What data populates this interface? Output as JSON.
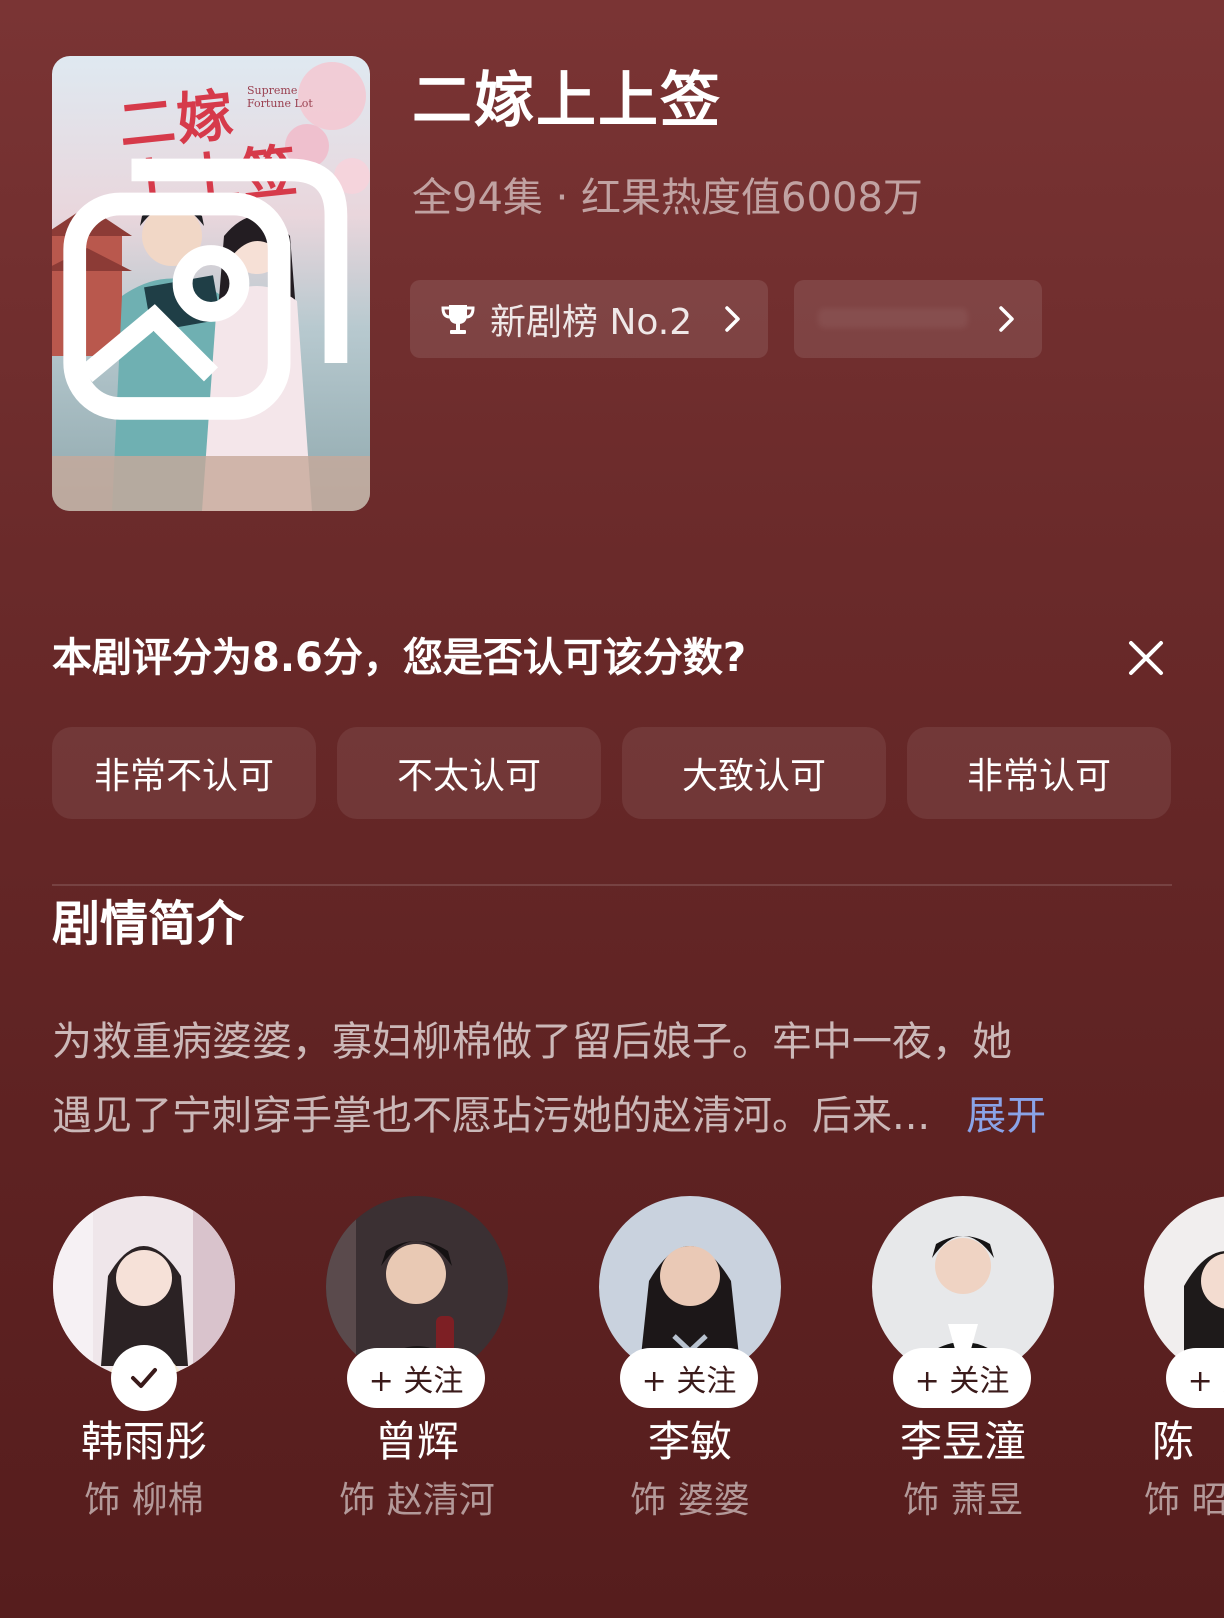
{
  "drama": {
    "title": "二嫁上上签",
    "meta": "全94集 · 红果热度值6008万",
    "poster_title": "二嫁\n上上签",
    "poster_subtitle": "Supreme\nFortune Lot",
    "rank_chip": "新剧榜 No.2"
  },
  "rating": {
    "question": "本剧评分为8.6分，您是否认可该分数?",
    "options": [
      "非常不认可",
      "不太认可",
      "大致认可",
      "非常认可"
    ]
  },
  "synopsis": {
    "section_title": "剧情简介",
    "line1": "为救重病婆婆，寡妇柳棉做了留后娘子。牢中一夜，她",
    "line2": "遇见了宁刺穿手掌也不愿玷污她的赵清河。后来...",
    "expand_label": "展开"
  },
  "cast": {
    "follow_label": "+ 关注",
    "members": [
      {
        "name": "韩雨彤",
        "role": "饰 柳棉"
      },
      {
        "name": "曾辉",
        "role": "饰 赵清河"
      },
      {
        "name": "李敏",
        "role": "饰 婆婆"
      },
      {
        "name": "李昱潼",
        "role": "饰 萧昱"
      },
      {
        "name": "陈",
        "role": "饰 昭"
      }
    ]
  },
  "icons": {
    "gallery": "gallery-icon",
    "trophy": "trophy-icon",
    "chevron": "chevron-right-icon",
    "close": "close-icon",
    "check": "check-icon"
  },
  "colors": {
    "background": "#6a2a2a",
    "link": "#8aa3e8",
    "poster_title": "#d63a4a"
  }
}
